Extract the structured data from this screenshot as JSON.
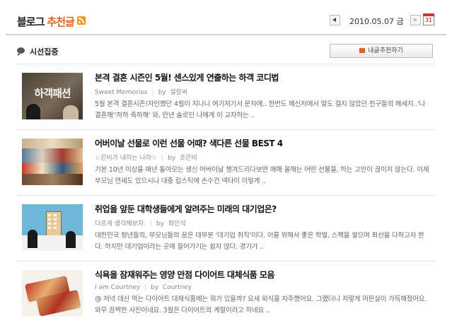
{
  "header": {
    "title_main": "블로그",
    "title_accent": "추천글",
    "date": "2010.05.07 금",
    "calendar_day": "31"
  },
  "section": {
    "title": "시선집중",
    "recommend_button": "내글추천하기"
  },
  "items": [
    {
      "title": "본격 결혼 시즌인 5월! 센스있게 연출하는 하객 코디법",
      "blog": "Sweet Memories",
      "by": "by",
      "author": "설랑씨",
      "desc": "5월 본격 결혼시즌!자인했던 4월이 지나니 여기저기서 문자에.. 한번도 메신저에서 말도 걸지 않았던 친구들의 메세지..'나 결혼해''하하 축하해' 와, 만년 솔로인 나에게 이 교차하는 ..",
      "thumb_text": "하객패션"
    },
    {
      "title": "어버이날 선물로 이런 선물 어때? 색다른 선물 BEST 4",
      "blog": "☆은비가 내리는 나라☆",
      "by": "by",
      "author": "조은비",
      "desc": "기본 10년 이상을 매년 돌아오는 생신 어버이날 챙겨드리다보면 매해 올해는 어떤 선물을, 하는 고민이 끊이지 않는다. 이제 부모님 연세도 있으시니 대충 립스틱에 손수건 넥타이 이렇게 .."
    },
    {
      "title": "취업을 앞둔 대학생들에게 알려주는 미래의 대기업은?",
      "blog": "다르게 생각해보자.",
      "by": "by",
      "author": "최인석",
      "desc": "대한민국 청년들의, 부모님들의 꿈은 대부분 '대기업 취직'이다. 이를 위해서 좋은 학벌, 스펙을 쌓으며 최선을 다하고자 한다. 하지만 대기업이라는 곳에 들어가기는 쉽지 않다. 경기가 .."
    },
    {
      "title": "식욕을 잠재워주는 영양 만점 다이어트 대체식품 모음",
      "blog": "I am Courtney",
      "by": "by",
      "author": "Courtney",
      "desc": "@ 저녁 대신 먹는 다이어트 대체식품에는 뭐가 있을까? 요새 외식을 자주했어요. 그랬더니 저렇게 머핀살이 가득해졌어요.와우 끔찍한 사진이네요. 3월은 다이어트의 계절이라고 하네요 .."
    }
  ]
}
